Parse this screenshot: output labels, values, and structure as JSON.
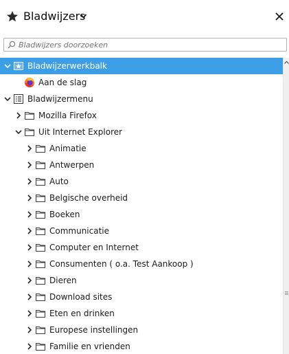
{
  "header": {
    "title": "Bladwijzers",
    "star_icon": "star-icon",
    "chevron_icon": "chevron-down-icon",
    "close_icon": "close-icon"
  },
  "search": {
    "placeholder": "Bladwijzers doorzoeken",
    "value": ""
  },
  "tree": [
    {
      "label": "Bladwijzerwerkbalk",
      "level": 0,
      "twisty": "expanded",
      "icon": "toolbar-star-icon",
      "selected": true
    },
    {
      "label": "Aan de slag",
      "level": 1,
      "twisty": "none",
      "icon": "firefox-icon",
      "selected": false
    },
    {
      "label": "Bladwijzermenu",
      "level": 0,
      "twisty": "expanded",
      "icon": "menu-icon",
      "selected": false
    },
    {
      "label": "Mozilla Firefox",
      "level": 1,
      "twisty": "collapsed",
      "icon": "folder-icon",
      "selected": false
    },
    {
      "label": "Uit Internet Explorer",
      "level": 1,
      "twisty": "expanded",
      "icon": "folder-icon",
      "selected": false
    },
    {
      "label": "Animatie",
      "level": 2,
      "twisty": "collapsed",
      "icon": "folder-icon",
      "selected": false
    },
    {
      "label": "Antwerpen",
      "level": 2,
      "twisty": "collapsed",
      "icon": "folder-icon",
      "selected": false
    },
    {
      "label": "Auto",
      "level": 2,
      "twisty": "collapsed",
      "icon": "folder-icon",
      "selected": false
    },
    {
      "label": "Belgische overheid",
      "level": 2,
      "twisty": "collapsed",
      "icon": "folder-icon",
      "selected": false
    },
    {
      "label": "Boeken",
      "level": 2,
      "twisty": "collapsed",
      "icon": "folder-icon",
      "selected": false
    },
    {
      "label": "Communicatie",
      "level": 2,
      "twisty": "collapsed",
      "icon": "folder-icon",
      "selected": false
    },
    {
      "label": "Computer en Internet",
      "level": 2,
      "twisty": "collapsed",
      "icon": "folder-icon",
      "selected": false
    },
    {
      "label": "Consumenten ( o.a. Test Aankoop )",
      "level": 2,
      "twisty": "collapsed",
      "icon": "folder-icon",
      "selected": false
    },
    {
      "label": "Dieren",
      "level": 2,
      "twisty": "collapsed",
      "icon": "folder-icon",
      "selected": false
    },
    {
      "label": "Download sites",
      "level": 2,
      "twisty": "collapsed",
      "icon": "folder-icon",
      "selected": false
    },
    {
      "label": "Eten en drinken",
      "level": 2,
      "twisty": "collapsed",
      "icon": "folder-icon",
      "selected": false
    },
    {
      "label": "Europese instellingen",
      "level": 2,
      "twisty": "collapsed",
      "icon": "folder-icon",
      "selected": false
    },
    {
      "label": "Familie en vrienden",
      "level": 2,
      "twisty": "collapsed",
      "icon": "folder-icon",
      "selected": false
    }
  ],
  "colors": {
    "selection": "#3d9ee8",
    "text": "#1a1a1a",
    "selected_text": "#ffffff",
    "icon": "#3a3a3a"
  }
}
